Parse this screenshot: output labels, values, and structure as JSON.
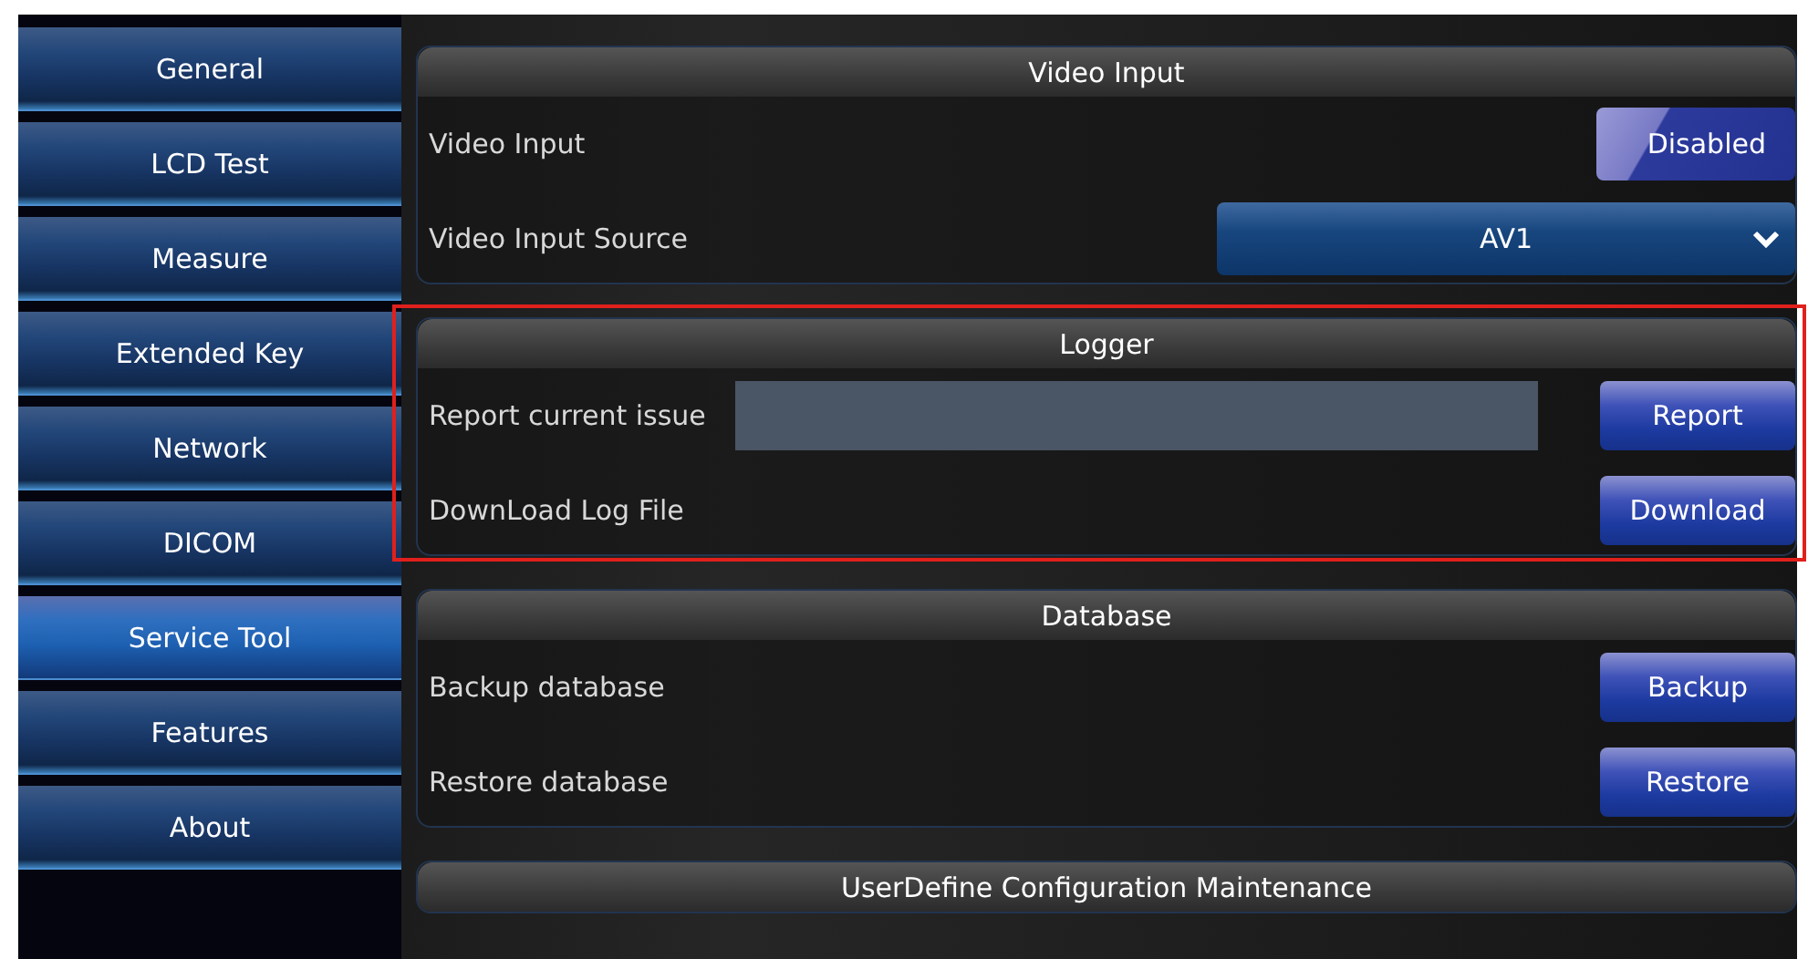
{
  "sidebar": {
    "items": [
      {
        "label": "General",
        "selected": false
      },
      {
        "label": "LCD Test",
        "selected": false
      },
      {
        "label": "Measure",
        "selected": false
      },
      {
        "label": "Extended Key",
        "selected": false
      },
      {
        "label": "Network",
        "selected": false
      },
      {
        "label": "DICOM",
        "selected": false
      },
      {
        "label": "Service Tool",
        "selected": true
      },
      {
        "label": "Features",
        "selected": false
      },
      {
        "label": "About",
        "selected": false
      }
    ]
  },
  "sections": [
    {
      "title": "Video Input",
      "highlighted": false,
      "rows": [
        {
          "kind": "toggle",
          "label": "Video Input",
          "value": "Disabled",
          "on": false
        },
        {
          "kind": "dropdown",
          "label": "Video Input Source",
          "value": "AV1"
        }
      ]
    },
    {
      "title": "Logger",
      "highlighted": true,
      "rows": [
        {
          "kind": "field_button",
          "label": "Report current issue",
          "button": "Report"
        },
        {
          "kind": "button",
          "label": "DownLoad Log File",
          "button": "Download"
        }
      ]
    },
    {
      "title": "Database",
      "highlighted": false,
      "rows": [
        {
          "kind": "button",
          "label": "Backup database",
          "button": "Backup"
        },
        {
          "kind": "button",
          "label": "Restore database",
          "button": "Restore"
        }
      ]
    },
    {
      "title": "UserDefine Configuration Maintenance",
      "highlighted": false
    }
  ]
}
